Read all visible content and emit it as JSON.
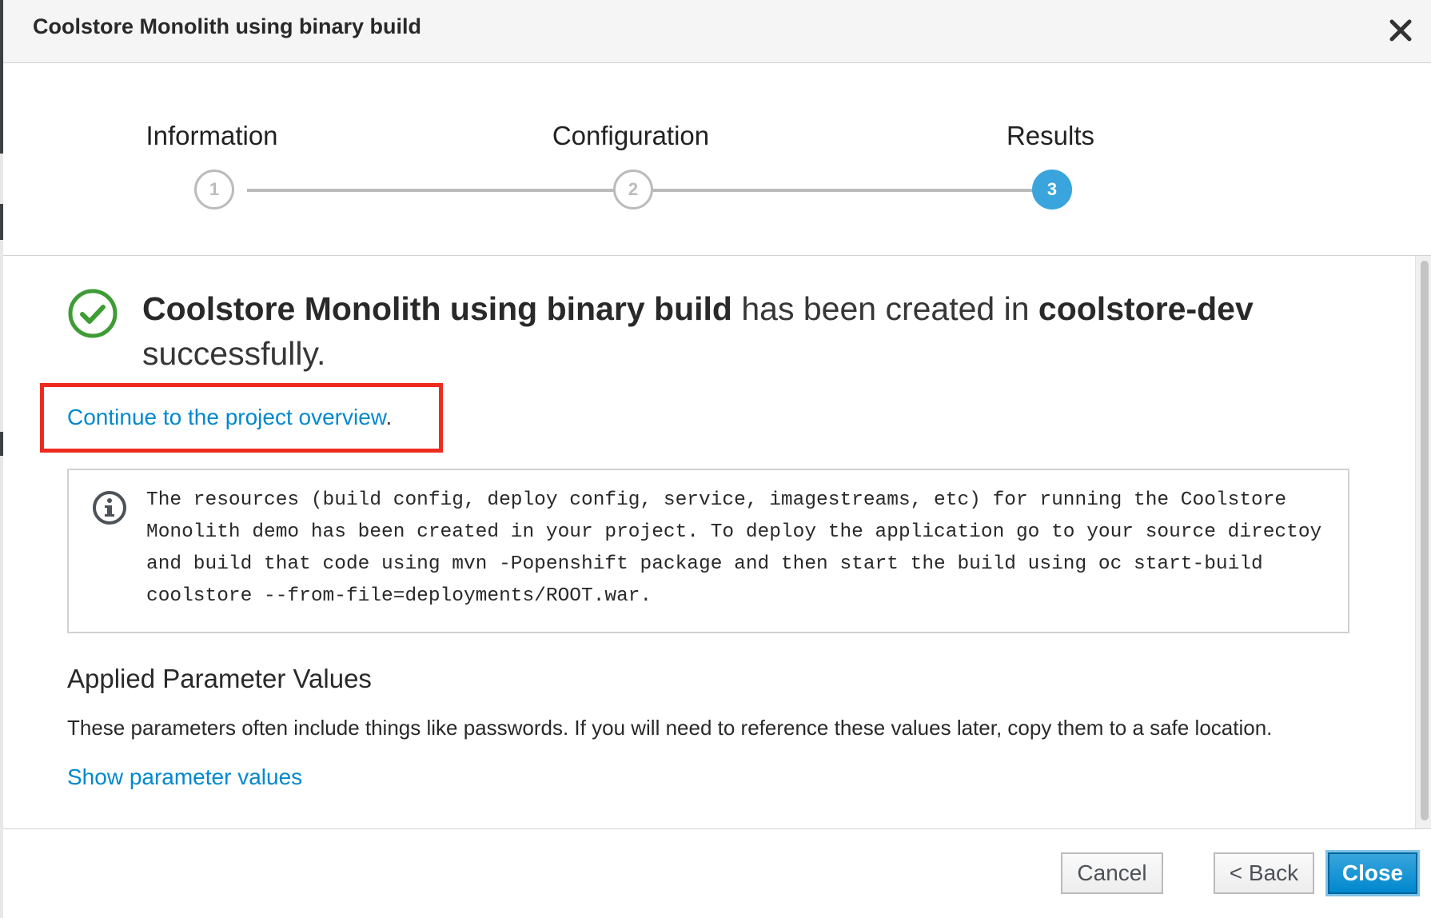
{
  "dialog": {
    "title": "Coolstore Monolith using binary build"
  },
  "wizard": {
    "steps": [
      {
        "label": "Information",
        "number": "1",
        "state": "complete"
      },
      {
        "label": "Configuration",
        "number": "2",
        "state": "complete"
      },
      {
        "label": "Results",
        "number": "3",
        "state": "active"
      }
    ]
  },
  "result": {
    "template_name": "Coolstore Monolith using binary build",
    "middle_text": " has been created in ",
    "project_name": "coolstore-dev",
    "end_text": " successfully.",
    "overview_link": "Continue to the project overview",
    "overview_link_suffix": "."
  },
  "info": {
    "message": "The resources (build config, deploy config, service, imagestreams, etc) for running the Coolstore Monolith demo has been created in your project. To deploy the application go to your source directoy and build that code using mvn -Popenshift package and then start the build using oc start-build coolstore --from-file=deployments/ROOT.war."
  },
  "parameters": {
    "heading": "Applied Parameter Values",
    "description": "These parameters often include things like passwords. If you will need to reference these values later, copy them to a safe location.",
    "show_link": "Show parameter values"
  },
  "footer": {
    "cancel_label": "Cancel",
    "back_label": "< Back",
    "close_label": "Close"
  },
  "colors": {
    "accent": "#0088ce",
    "active_step": "#39a5dc",
    "success": "#3f9c35",
    "highlight": "#ee2b1f"
  },
  "icons": {
    "close": "close-icon",
    "success": "check-circle-icon",
    "info": "info-circle-icon"
  }
}
